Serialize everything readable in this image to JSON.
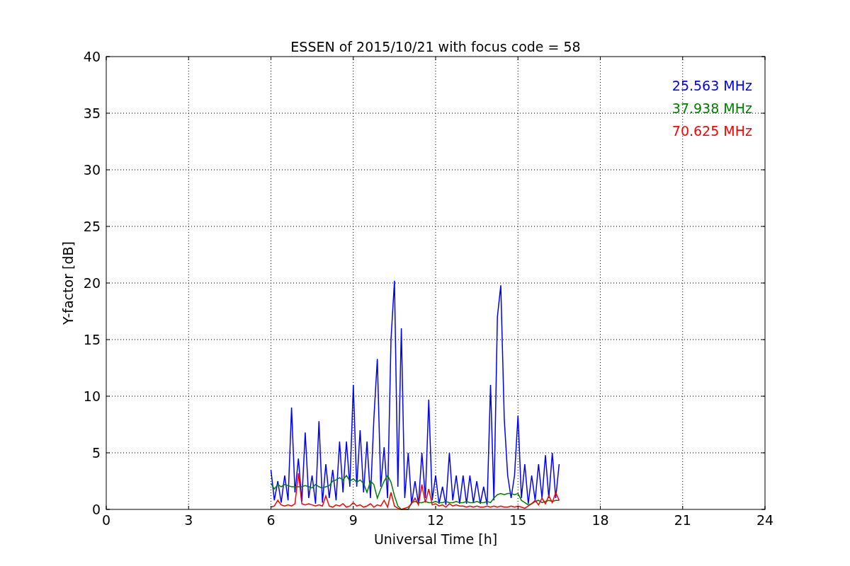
{
  "figure": {
    "chart_data": {
      "type": "line",
      "title": "ESSEN of 2015/10/21 with focus code = 58",
      "xlabel": "Universal Time [h]",
      "ylabel": "Y-factor [dB]",
      "grid": true,
      "xlim": [
        0,
        24
      ],
      "ylim": [
        0,
        40
      ],
      "xticks": [
        0,
        3,
        6,
        9,
        12,
        15,
        18,
        21,
        24
      ],
      "yticks": [
        0,
        5,
        10,
        15,
        20,
        25,
        30,
        35,
        40
      ],
      "x": [
        6.0,
        6.125,
        6.25,
        6.375,
        6.5,
        6.625,
        6.75,
        6.875,
        7.0,
        7.125,
        7.25,
        7.375,
        7.5,
        7.625,
        7.75,
        7.875,
        8.0,
        8.125,
        8.25,
        8.375,
        8.5,
        8.625,
        8.75,
        8.875,
        9.0,
        9.125,
        9.25,
        9.375,
        9.5,
        9.625,
        9.75,
        9.875,
        10.0,
        10.125,
        10.25,
        10.375,
        10.5,
        10.625,
        10.75,
        10.875,
        11.0,
        11.125,
        11.25,
        11.375,
        11.5,
        11.625,
        11.75,
        11.875,
        12.0,
        12.125,
        12.25,
        12.375,
        12.5,
        12.625,
        12.75,
        12.875,
        13.0,
        13.125,
        13.25,
        13.375,
        13.5,
        13.625,
        13.75,
        13.875,
        14.0,
        14.125,
        14.25,
        14.375,
        14.5,
        14.625,
        14.75,
        14.875,
        15.0,
        15.125,
        15.25,
        15.375,
        15.5,
        15.625,
        15.75,
        15.875,
        16.0,
        16.125,
        16.25,
        16.375,
        16.5
      ],
      "series": [
        {
          "name": "25.563 MHz",
          "color": "#0000ff",
          "values": [
            3.5,
            0.8,
            2.5,
            0.6,
            3,
            0.8,
            9,
            1.5,
            4.5,
            0.7,
            6.8,
            1,
            3,
            0.5,
            7.8,
            0.6,
            4,
            1,
            3.5,
            0.8,
            6,
            1.5,
            6,
            2,
            11,
            2,
            7,
            1.5,
            6,
            1,
            8,
            13.3,
            2,
            5.5,
            1,
            15,
            20.2,
            2,
            16,
            1,
            5,
            0.5,
            2.5,
            0.5,
            5,
            1,
            9.7,
            0.8,
            3,
            0.5,
            2,
            0.4,
            5,
            0.8,
            3,
            0.5,
            3,
            0.5,
            3,
            0.6,
            2.5,
            0.5,
            2,
            0.4,
            11,
            0.8,
            17,
            19.8,
            8,
            3,
            1,
            3,
            8.3,
            1,
            4,
            0.5,
            3,
            0.8,
            4,
            1,
            4.8,
            1,
            5,
            1,
            4
          ]
        },
        {
          "name": "37.938 MHz",
          "color": "#008000",
          "values": [
            2.3,
            1.8,
            2.2,
            2.0,
            2.2,
            2.1,
            2.0,
            2.0,
            2.0,
            2.0,
            2.1,
            2.0,
            1.9,
            2.2,
            2.0,
            1.9,
            2.0,
            2.1,
            2.5,
            2.6,
            2.8,
            2.6,
            3.0,
            2.5,
            2.7,
            2.4,
            2.6,
            2.3,
            1.5,
            2.5,
            2.2,
            1.0,
            1.8,
            2.5,
            3.0,
            2.4,
            1.2,
            0.3,
            0.0,
            0.0,
            0.0,
            0.6,
            0.7,
            0.6,
            0.6,
            0.7,
            0.6,
            0.6,
            0.7,
            0.6,
            0.6,
            0.7,
            0.6,
            0.6,
            0.7,
            0.6,
            0.6,
            0.7,
            0.6,
            0.6,
            0.7,
            0.6,
            0.6,
            0.7,
            0.6,
            1.0,
            1.3,
            1.4,
            1.3,
            1.4,
            1.4,
            1.3,
            1.4,
            0.8,
            0.6,
            0.4,
            0.5,
            0.7,
            0.8,
            0.6,
            0.7,
            0.8,
            0.7,
            0.8,
            0.8
          ]
        },
        {
          "name": "70.625 MHz",
          "color": "#ff0000",
          "values": [
            0.2,
            0.3,
            0.8,
            0.4,
            0.3,
            0.4,
            0.3,
            0.5,
            3.2,
            0.5,
            0.4,
            0.5,
            0.4,
            0.3,
            0.4,
            0.3,
            1.2,
            0.3,
            0.2,
            0.4,
            0.3,
            0.5,
            0.2,
            0.3,
            0.6,
            0.3,
            0.4,
            0.2,
            0.3,
            0.5,
            0.2,
            0.4,
            0.3,
            0.8,
            0.2,
            1.5,
            0.3,
            0.1,
            0.0,
            0.1,
            0.2,
            0.5,
            1.0,
            0.4,
            2.2,
            0.6,
            1.8,
            0.4,
            0.5,
            0.3,
            0.4,
            0.2,
            0.5,
            0.3,
            0.4,
            0.3,
            0.3,
            0.2,
            0.3,
            0.2,
            0.3,
            0.2,
            0.2,
            0.3,
            0.2,
            0.3,
            0.2,
            0.3,
            0.2,
            0.2,
            0.3,
            0.2,
            0.3,
            0.2,
            0.1,
            0.3,
            0.5,
            0.8,
            0.4,
            1.0,
            0.5,
            1.2,
            0.6,
            1.5,
            0.8
          ]
        }
      ]
    }
  }
}
